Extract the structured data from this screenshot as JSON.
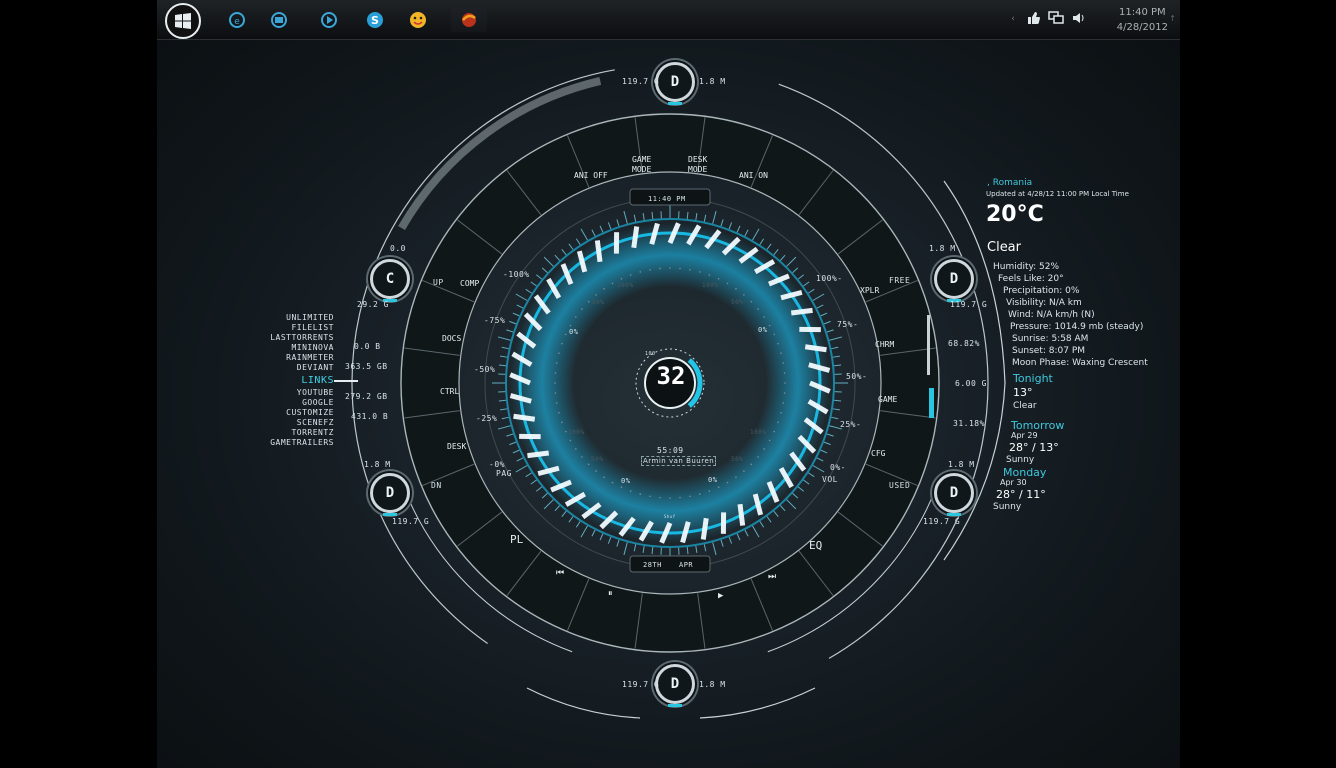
{
  "taskbar": {
    "clock_time": "11:40 PM",
    "clock_date": "4/28/2012",
    "icons": [
      "ie-icon",
      "explorer-icon",
      "media-player-icon",
      "skype-icon",
      "messenger-icon",
      "firefox-icon"
    ],
    "tray": [
      "tray-arrow-icon",
      "thumbs-up-icon",
      "network-icon",
      "volume-icon"
    ]
  },
  "hud": {
    "time": "11:40   PM",
    "date_day": "28TH",
    "date_month": "APR",
    "center_value": "32",
    "center_small": "100",
    "track_time": "55:09",
    "track_artist": "Armin van Buuren",
    "play_label": "Shuf",
    "ring_buttons": {
      "ani_off": "ANI OFF",
      "game_mode_1": "GAME",
      "game_mode_2": "MODE",
      "desk_mode_1": "DESK",
      "desk_mode_2": "MODE",
      "ani_on": "ANI ON",
      "comp": "COMP",
      "docs": "DOCS",
      "ctrl": "CTRL",
      "desk": "DESK",
      "xplr": "XPLR",
      "chrm": "CHRM",
      "game": "GAME",
      "cfg": "CFG",
      "pl": "PL",
      "eq": "EQ"
    },
    "side_labels": {
      "up": "UP",
      "dn": "DN",
      "pag": "PAG",
      "free": "FREE",
      "used": "USED",
      "vol": "VOL"
    },
    "left_scale": [
      "-100%",
      "-75%",
      "-50%",
      "-25%",
      "-0%"
    ],
    "right_scale": [
      "100%-",
      "75%-",
      "50%-",
      "25%-",
      "0%-"
    ],
    "inner_ticks": [
      "0%",
      "0%",
      "0%",
      "0%",
      "50%",
      "50%",
      "50%",
      "50%",
      "100%",
      "100%",
      "100%",
      "100%"
    ],
    "drives": {
      "top": {
        "letter": "D",
        "left": "119.7 G",
        "right": "1.8 M"
      },
      "bottom": {
        "letter": "D",
        "left": "119.7 G",
        "right": "1.8 M"
      },
      "c": {
        "letter": "C",
        "top": "0.0",
        "bottom": "29.2 G"
      },
      "left_d": {
        "letter": "D",
        "top": "1.8 M",
        "bottom": "119.7 G"
      },
      "right_d_top": {
        "letter": "D",
        "top": "1.8 M",
        "bottom": "119.7 G"
      },
      "right_d_bottom": {
        "letter": "D",
        "top": "1.8 M",
        "bottom": "119.7 G"
      }
    },
    "net_stats": [
      "0.0 B",
      "363.5 GB",
      "279.2 GB",
      "431.0 B"
    ],
    "right_stats": [
      "68.82%",
      "6.00 G",
      "31.18%"
    ]
  },
  "links": {
    "top": [
      "UNLIMITED",
      "FILELIST",
      "LASTTORRENTS",
      "MININOVA",
      "RAINMETER",
      "DEVIANT"
    ],
    "header": "LINKS",
    "bottom": [
      "YOUTUBE",
      "GOOGLE",
      "CUSTOMIZE",
      "SCENEFZ",
      "TORRENTZ",
      "GAMETRAILERS"
    ]
  },
  "weather": {
    "location": ", Romania",
    "updated": "Updated at 4/28/12 11:00 PM Local Time",
    "temp": "20°C",
    "condition": "Clear",
    "humidity": "Humidity: 52%",
    "feels_like": "Feels Like: 20°",
    "precip": "Precipitation: 0%",
    "visibility": "Visibility: N/A km",
    "wind": "Wind: N/A km/h (N)",
    "pressure": "Pressure: 1014.9 mb (steady)",
    "sunrise": "Sunrise: 5:58 AM",
    "sunset": "Sunset:  8:07 PM",
    "moon": "Moon Phase: Waxing Crescent",
    "tonight_label": "Tonight",
    "tonight_temp": "13°",
    "tonight_cond": "Clear",
    "tomorrow_label": "Tomorrow",
    "tomorrow_date": "Apr 29",
    "tomorrow_temp": "28° / 13°",
    "tomorrow_cond": "Sunny",
    "monday_label": "Monday",
    "monday_date": "Apr 30",
    "monday_temp": "28° / 11°",
    "monday_cond": "Sunny"
  }
}
